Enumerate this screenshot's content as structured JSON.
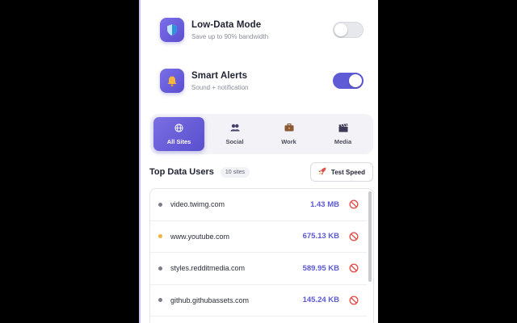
{
  "settings": [
    {
      "title": "Low-Data Mode",
      "subtitle": "Save up to 90% bandwidth",
      "enabled": false,
      "icon": "shield-icon"
    },
    {
      "title": "Smart Alerts",
      "subtitle": "Sound + notification",
      "enabled": true,
      "icon": "bell-icon"
    }
  ],
  "tabs": [
    {
      "label": "All Sites",
      "icon": "globe-icon",
      "active": true
    },
    {
      "label": "Social",
      "icon": "people-icon",
      "active": false
    },
    {
      "label": "Work",
      "icon": "briefcase-icon",
      "active": false
    },
    {
      "label": "Media",
      "icon": "clapper-icon",
      "active": false
    }
  ],
  "section": {
    "title": "Top Data Users",
    "count": "10 sites",
    "test_speed_label": "Test Speed"
  },
  "sites": [
    {
      "domain": "video.twimg.com",
      "size": "1.43 MB",
      "status": "normal"
    },
    {
      "domain": "www.youtube.com",
      "size": "675.13 KB",
      "status": "warning"
    },
    {
      "domain": "styles.redditmedia.com",
      "size": "589.95 KB",
      "status": "normal"
    },
    {
      "domain": "github.githubassets.com",
      "size": "145.24 KB",
      "status": "normal"
    }
  ],
  "colors": {
    "accent": "#5f5ad6",
    "warning": "#f4b23e",
    "block": "#e0524f"
  }
}
